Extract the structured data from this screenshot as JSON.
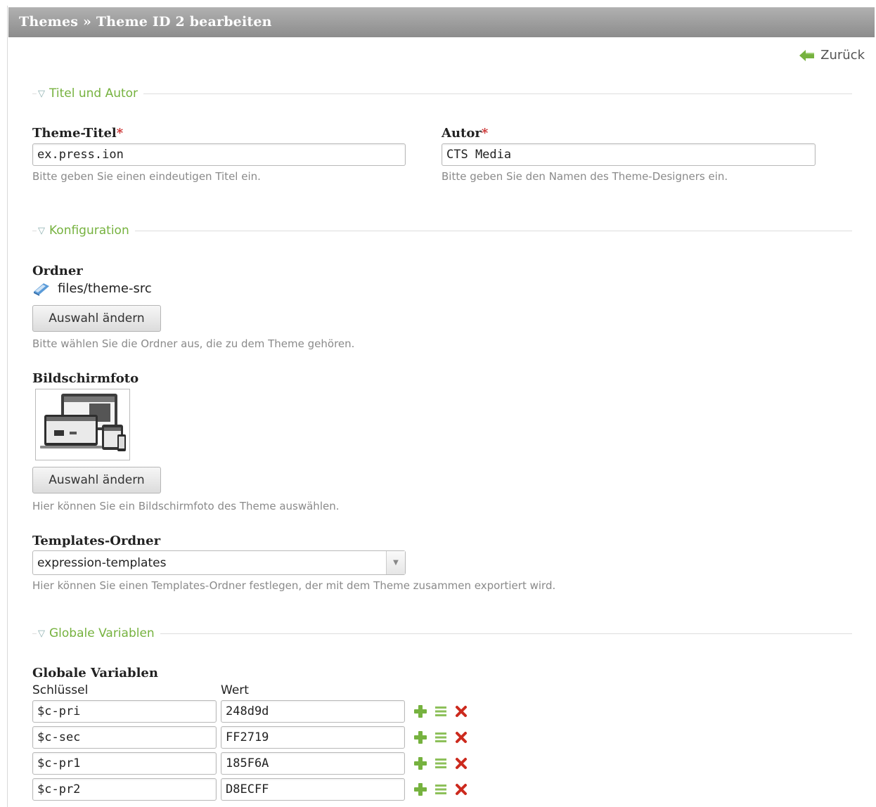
{
  "header": {
    "title": "Themes » Theme ID 2 bearbeiten"
  },
  "nav": {
    "back_label": "Zurück"
  },
  "sections": {
    "title_author": "Titel und Autor",
    "config": "Konfiguration",
    "globals": "Globale Variablen"
  },
  "fields": {
    "theme_title": {
      "label": "Theme-Titel",
      "required_mark": "*",
      "value": "ex.press.ion",
      "help": "Bitte geben Sie einen eindeutigen Titel ein."
    },
    "author": {
      "label": "Autor",
      "required_mark": "*",
      "value": "CTS Media",
      "help": "Bitte geben Sie den Namen des Theme-Designers ein."
    },
    "folder": {
      "label": "Ordner",
      "path": "files/theme-src",
      "button": "Auswahl ändern",
      "help": "Bitte wählen Sie die Ordner aus, die zu dem Theme gehören."
    },
    "screenshot": {
      "label": "Bildschirmfoto",
      "button": "Auswahl ändern",
      "help": "Hier können Sie ein Bildschirmfoto des Theme auswählen."
    },
    "templates": {
      "label": "Templates-Ordner",
      "value": "expression-templates",
      "help": "Hier können Sie einen Templates-Ordner festlegen, der mit dem Theme zusammen exportiert wird."
    },
    "globals": {
      "label": "Globale Variablen",
      "key_header": "Schlüssel",
      "value_header": "Wert",
      "rows": [
        {
          "key": "$c-pri",
          "value": "248d9d"
        },
        {
          "key": "$c-sec",
          "value": "FF2719"
        },
        {
          "key": "$c-pr1",
          "value": "185F6A"
        },
        {
          "key": "$c-pr2",
          "value": "D8ECFF"
        }
      ]
    }
  },
  "icons": {
    "back": "arrow-left-icon",
    "folder": "folder-icon",
    "add": "plus-icon",
    "move": "drag-handle-icon",
    "delete": "delete-icon",
    "dropdown": "chevron-down-icon"
  },
  "colors": {
    "section_legend": "#76b23f",
    "add_icon": "#76b23f",
    "delete_icon": "#cc2a1e",
    "header_bg": "#9e9e9e"
  }
}
